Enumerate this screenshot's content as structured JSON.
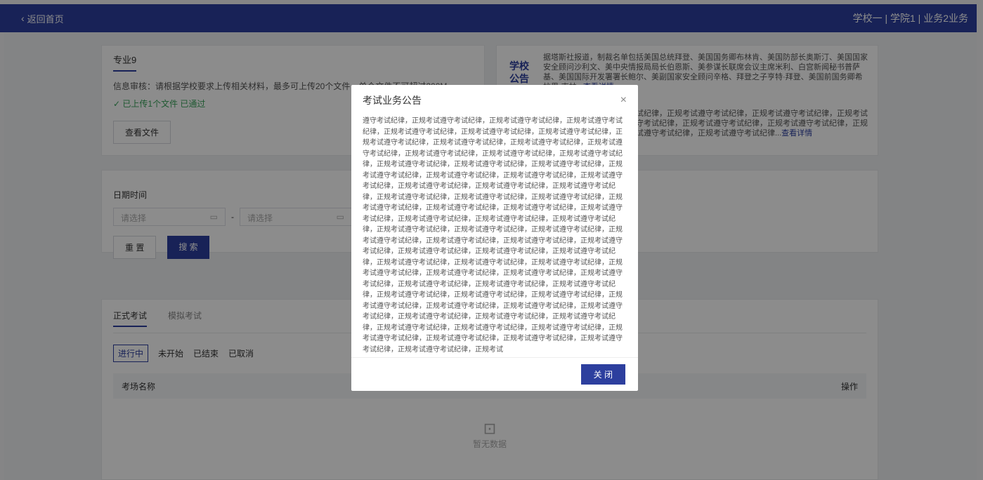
{
  "topbar": {
    "back_label": "返回首页",
    "org": "学校一 | 学院1 | 业务2业务"
  },
  "major": {
    "title": "专业9",
    "info": "信息审核：请根据学校要求上传相关材料，最多可上传20个文件，单个文件不可超过200M",
    "upload_status": "✓ 已上传1个文件   已通过",
    "view_files": "查看文件"
  },
  "notice": {
    "badge": "学校公告",
    "text1": "据塔斯社报道，制裁名单包括美国总统拜登、美国国务卿布林肯、美国防部长奥斯汀、美国国家安全顾问沙利文、美中央情报局局长伯恩斯、美参谋长联席会议主席米利、白宫新闻秘书普萨基、美国国际开发署署长鲍尔、美副国家安全顾问辛格、拜登之子亨特·拜登、美国前国务卿希拉里·克林...",
    "more1": "查看详情",
    "text2": "考试纪律，正规考试遵守考试纪律，正规考试遵守考试纪律，正规考试遵守考试纪律，正规考试遵守考试纪律，正规考试遵守考试纪律，正规考试遵守考试纪律，正规考试遵守考试纪律，正规考试遵守考试纪律，正规考试遵守考试纪律，正规考试遵守考试纪律...",
    "more2": "查看详情"
  },
  "filter": {
    "date_label": "日期时间",
    "start_placeholder": "请选择",
    "end_placeholder": "请选择",
    "reset": "重 置",
    "search": "搜 索"
  },
  "exams": {
    "tabs": [
      "正式考试",
      "模拟考试"
    ],
    "statuses": [
      "进行中",
      "未开始",
      "已结束",
      "已取消"
    ],
    "col_name": "考场名称",
    "col_action": "操作",
    "empty": "暂无数据"
  },
  "modal": {
    "title": "考试业务公告",
    "body": "遵守考试纪律，正规考试遵守考试纪律，正规考试遵守考试纪律，正规考试遵守考试纪律，正规考试遵守考试纪律，正规考试遵守考试纪律，正规考试遵守考试纪律，正规考试遵守考试纪律，正规考试遵守考试纪律，正规考试遵守考试纪律，正规考试遵守考试纪律，正规考试遵守考试纪律，正规考试遵守考试纪律，正规考试遵守考试纪律，正规考试遵守考试纪律，正规考试遵守考试纪律，正规考试遵守考试纪律，正规考试遵守考试纪律，正规考试遵守考试纪律，正规考试遵守考试纪律，正规考试遵守考试纪律，正规考试遵守考试纪律，正规考试遵守考试纪律，正规考试遵守考试纪律，正规考试遵守考试纪律，正规考试遵守考试纪律，正规考试遵守考试纪律，正规考试遵守考试纪律，正规考试遵守考试纪律，正规考试遵守考试纪律，正规考试遵守考试纪律，正规考试遵守考试纪律，正规考试遵守考试纪律，正规考试遵守考试纪律，正规考试遵守考试纪律，正规考试遵守考试纪律，正规考试遵守考试纪律，正规考试遵守考试纪律，正规考试遵守考试纪律，正规考试遵守考试纪律，正规考试遵守考试纪律，正规考试遵守考试纪律，正规考试遵守考试纪律，正规考试遵守考试纪律，正规考试遵守考试纪律，正规考试遵守考试纪律，正规考试遵守考试纪律，正规考试遵守考试纪律，正规考试遵守考试纪律，正规考试遵守考试纪律，正规考试遵守考试纪律，正规考试遵守考试纪律，正规考试遵守考试纪律，正规考试遵守考试纪律，正规考试遵守考试纪律，正规考试遵守考试纪律，正规考试遵守考试纪律，正规考试遵守考试纪律，正规考试遵守考试纪律，正规考试遵守考试纪律，正规考试遵守考试纪律，正规考试遵守考试纪律，正规考试遵守考试纪律，正规考试遵守考试纪律，正规考试遵守考试纪律，正规考试遵守考试纪律，正规考试遵守考试纪律，正规考试遵守考试纪律，正规考试遵守考试纪律，正规考试遵守考试纪律，正规考试遵守考试纪律，正规考试遵守考试纪律，正规考试",
    "close_label": "关 闭"
  }
}
